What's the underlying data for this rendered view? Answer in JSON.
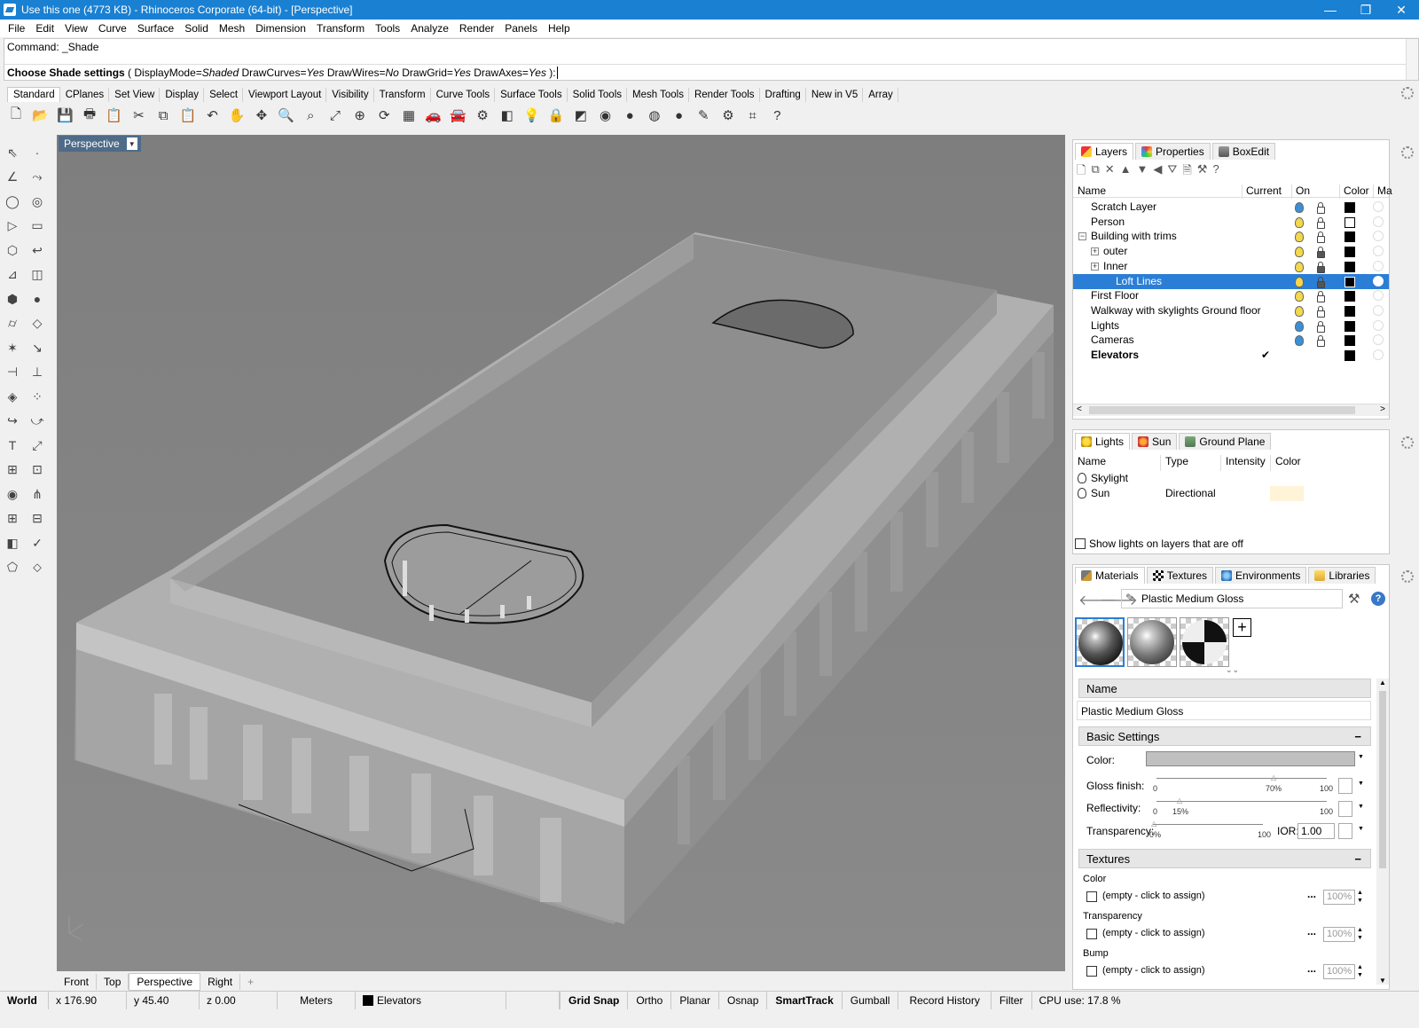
{
  "window": {
    "title": "Use this one (4773 KB) - Rhinoceros Corporate (64-bit) - [Perspective]",
    "controls": [
      "—",
      "❐",
      "✕"
    ]
  },
  "menu": [
    "File",
    "Edit",
    "View",
    "Curve",
    "Surface",
    "Solid",
    "Mesh",
    "Dimension",
    "Transform",
    "Tools",
    "Analyze",
    "Render",
    "Panels",
    "Help"
  ],
  "command": {
    "history": "Command: _Shade",
    "prompt_bold": "Choose Shade settings",
    "prompt_rest_parts": [
      {
        "t": " ( ",
        "i": false
      },
      {
        "t": "DisplayMode=",
        "i": false
      },
      {
        "t": "Shaded",
        "i": true
      },
      {
        "t": "  DrawCurves=",
        "i": false
      },
      {
        "t": "Yes",
        "i": true
      },
      {
        "t": "  DrawWires=",
        "i": false
      },
      {
        "t": "No",
        "i": true
      },
      {
        "t": "  DrawGrid=",
        "i": false
      },
      {
        "t": "Yes",
        "i": true
      },
      {
        "t": "  DrawAxes=",
        "i": false
      },
      {
        "t": "Yes",
        "i": true
      },
      {
        "t": " ): ",
        "i": false
      }
    ]
  },
  "toolbar_tabs": [
    "Standard",
    "CPlanes",
    "Set View",
    "Display",
    "Select",
    "Viewport Layout",
    "Visibility",
    "Transform",
    "Curve Tools",
    "Surface Tools",
    "Solid Tools",
    "Mesh Tools",
    "Render Tools",
    "Drafting",
    "New in V5",
    "Array"
  ],
  "toolbar_icons": [
    "new-file-icon",
    "open-folder-icon",
    "save-icon",
    "print-icon",
    "import-icon",
    "cut-icon",
    "copy-icon",
    "paste-icon",
    "undo-icon",
    "pan-hand-icon",
    "move-view-icon",
    "zoom-icon",
    "zoom-window-icon",
    "zoom-extents-icon",
    "zoom-selected-icon",
    "rotate-view-icon",
    "four-viewports-icon",
    "car-icon",
    "car-ghost-icon",
    "options-icon",
    "layers-icon",
    "light-bulb-icon",
    "lock-icon",
    "layer-color-icon",
    "color-wheel-icon",
    "render-sphere-icon",
    "sphere-ghost-icon",
    "sphere-blue-icon",
    "brush-icon",
    "gear-icon",
    "grid-snap-icon",
    "help-icon"
  ],
  "toolbar_glyphs": [
    "🗋",
    "📂",
    "💾",
    "🖶",
    "📋",
    "✂",
    "⧉",
    "📋",
    "↶",
    "✋",
    "✥",
    "🔍",
    "⌕",
    "⤢",
    "⊕",
    "⟳",
    "▦",
    "🚗",
    "🚘",
    "⚙",
    "◧",
    "💡",
    "🔒",
    "◩",
    "◉",
    "●",
    "◍",
    "●",
    "✎",
    "⚙",
    "⌗",
    "?"
  ],
  "left_tools": [
    "⇖",
    "·",
    "∠",
    "⤳",
    "◯",
    "◎",
    "▷",
    "▭",
    "⬡",
    "↩",
    "⊿",
    "◫",
    "⬢",
    "●",
    "⌭",
    "◇",
    "✶",
    "↘",
    "⊣",
    "⊥",
    "◈",
    "⁘",
    "↪",
    "⤻",
    "T",
    "⤢",
    "⊞",
    "⊡",
    "◉",
    "⋔",
    "⊞",
    "⊟",
    "◧",
    "✓",
    "⬠",
    "⬦"
  ],
  "viewport": {
    "name": "Perspective",
    "bottom_tabs": [
      "Front",
      "Top",
      "Perspective",
      "Right"
    ],
    "add_tab": "+"
  },
  "status": {
    "cplane": "World",
    "x": "x 176.90",
    "y": "y 45.40",
    "z": "z 0.00",
    "units": "Meters",
    "layer": "Elevators",
    "toggles": [
      "Grid Snap",
      "Ortho",
      "Planar",
      "Osnap",
      "SmartTrack",
      "Gumball",
      "Record History",
      "Filter"
    ],
    "cpu": "CPU use: 17.8 %"
  },
  "layers_panel": {
    "tabs": [
      "Layers",
      "Properties",
      "BoxEdit"
    ],
    "columns": [
      "Name",
      "Current",
      "On",
      "Color",
      "Ma"
    ],
    "rows": [
      {
        "name": "Scratch Layer",
        "indent": 0,
        "bulb": "#3b8fd6",
        "lock": false,
        "color": "#000000",
        "expand": "",
        "current": "",
        "selected": false,
        "bold": false
      },
      {
        "name": "Person",
        "indent": 0,
        "bulb": "#f3d94a",
        "lock": false,
        "color": "#ffffff",
        "expand": "",
        "current": "",
        "selected": false,
        "bold": false
      },
      {
        "name": "Building with trims",
        "indent": 0,
        "bulb": "#f3d94a",
        "lock": false,
        "color": "#000000",
        "expand": "−",
        "current": "",
        "selected": false,
        "bold": false
      },
      {
        "name": "outer",
        "indent": 1,
        "bulb": "#f3d94a",
        "lock": true,
        "color": "#000000",
        "expand": "+",
        "current": "",
        "selected": false,
        "bold": false
      },
      {
        "name": "Inner",
        "indent": 1,
        "bulb": "#f3d94a",
        "lock": true,
        "color": "#000000",
        "expand": "+",
        "current": "",
        "selected": false,
        "bold": false
      },
      {
        "name": "Loft Lines",
        "indent": 2,
        "bulb": "#f3d94a",
        "lock": true,
        "color": "#000000",
        "expand": "",
        "current": "",
        "selected": true,
        "bold": false
      },
      {
        "name": "First Floor",
        "indent": 0,
        "bulb": "#f3d94a",
        "lock": false,
        "color": "#000000",
        "expand": "",
        "current": "",
        "selected": false,
        "bold": false
      },
      {
        "name": "Walkway with skylights Ground floor",
        "indent": 0,
        "bulb": "#f3d94a",
        "lock": false,
        "color": "#000000",
        "expand": "",
        "current": "",
        "selected": false,
        "bold": false
      },
      {
        "name": "Lights",
        "indent": 0,
        "bulb": "#3b8fd6",
        "lock": false,
        "color": "#000000",
        "expand": "",
        "current": "",
        "selected": false,
        "bold": false
      },
      {
        "name": "Cameras",
        "indent": 0,
        "bulb": "#3b8fd6",
        "lock": false,
        "color": "#000000",
        "expand": "",
        "current": "",
        "selected": false,
        "bold": false
      },
      {
        "name": "Elevators",
        "indent": 0,
        "bulb": "",
        "lock": false,
        "color": "#000000",
        "expand": "",
        "current": "✔",
        "selected": false,
        "bold": true
      }
    ]
  },
  "lights_panel": {
    "tabs": [
      "Lights",
      "Sun",
      "Ground Plane"
    ],
    "columns": [
      "Name",
      "Type",
      "Intensity",
      "Color"
    ],
    "rows": [
      {
        "name": "Skylight",
        "type": ""
      },
      {
        "name": "Sun",
        "type": "Directional"
      }
    ],
    "show_off_label": "Show lights on layers that are off"
  },
  "materials_panel": {
    "tabs": [
      "Materials",
      "Textures",
      "Environments",
      "Libraries"
    ],
    "current": "Plastic Medium Gloss",
    "name_section": "Name",
    "name_value": "Plastic Medium Gloss",
    "basic_section": "Basic Settings",
    "color_label": "Color:",
    "gloss_label": "Gloss finish:",
    "gloss_value": "70%",
    "reflect_label": "Reflectivity:",
    "reflect_value": "15%",
    "transp_label": "Transparency:",
    "transp_value": "0%",
    "ior_label": "IOR:",
    "ior_value": "1.00",
    "min": "0",
    "max": "100",
    "textures_section": "Textures",
    "texture_slots": [
      {
        "label": "Color",
        "value": "(empty - click to assign)",
        "pct": "100%"
      },
      {
        "label": "Transparency",
        "value": "(empty - click to assign)",
        "pct": "100%"
      },
      {
        "label": "Bump",
        "value": "(empty - click to assign)",
        "pct": "100%"
      }
    ],
    "add_glyph": "+",
    "dots": "...",
    "collapse": "−"
  }
}
